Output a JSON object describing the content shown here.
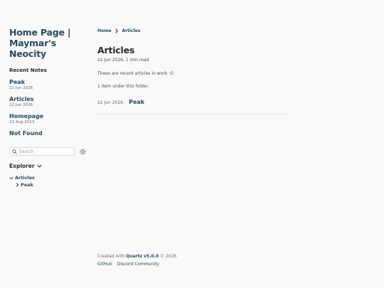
{
  "site": {
    "title_line1": "Home Page |",
    "title_line2": "Maymar's Neocity"
  },
  "recent": {
    "heading": "Recent Notes",
    "notes": [
      {
        "title": "Peak",
        "date": "22 Jun 2026"
      },
      {
        "title": "Articles",
        "date": "22 Jun 2026"
      },
      {
        "title": "Homepage",
        "date": "23 Aug 2023"
      },
      {
        "title": "Not Found",
        "date": ""
      }
    ]
  },
  "search": {
    "placeholder": "Search"
  },
  "explorer": {
    "heading": "Explorer",
    "folder": "Articles",
    "child": "Peak"
  },
  "breadcrumb": {
    "home": "Home",
    "separator": "❯",
    "current": "Articles"
  },
  "article": {
    "title": "Articles",
    "meta": "22 Jun 2026,  1 min read",
    "intro": "These are recent articles in work :O",
    "count": "1 item under this folder.",
    "listing": {
      "date": "22 Jun 2026",
      "title": "Peak"
    }
  },
  "footer": {
    "created_prefix": "Created with ",
    "quartz": "Quartz v5.0.0",
    "year": " © 2026",
    "links": [
      "GitHub",
      "Discord Community"
    ]
  },
  "colors": {
    "accent": "#284b63",
    "background": "#faf8f8",
    "text": "#2b2b2b"
  }
}
